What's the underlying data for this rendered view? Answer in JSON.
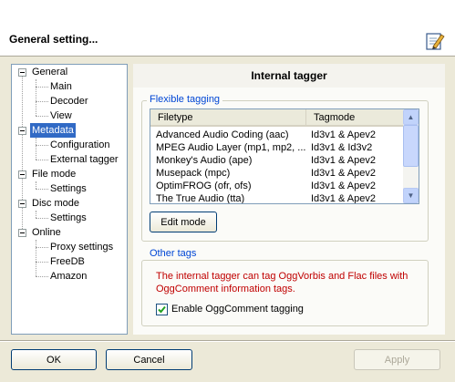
{
  "header": {
    "title": "General setting..."
  },
  "tree": {
    "items": [
      {
        "label": "General",
        "level": 0,
        "expanded": true,
        "selected": false
      },
      {
        "label": "Main",
        "level": 1,
        "selected": false
      },
      {
        "label": "Decoder",
        "level": 1,
        "selected": false
      },
      {
        "label": "View",
        "level": 1,
        "selected": false
      },
      {
        "label": "Metadata",
        "level": 0,
        "expanded": true,
        "selected": true
      },
      {
        "label": "Configuration",
        "level": 1,
        "selected": false
      },
      {
        "label": "External tagger",
        "level": 1,
        "selected": false
      },
      {
        "label": "File mode",
        "level": 0,
        "expanded": true,
        "selected": false
      },
      {
        "label": "Settings",
        "level": 1,
        "selected": false
      },
      {
        "label": "Disc mode",
        "level": 0,
        "expanded": true,
        "selected": false
      },
      {
        "label": "Settings",
        "level": 1,
        "selected": false
      },
      {
        "label": "Online",
        "level": 0,
        "expanded": true,
        "selected": false
      },
      {
        "label": "Proxy settings",
        "level": 1,
        "selected": false
      },
      {
        "label": "FreeDB",
        "level": 1,
        "selected": false
      },
      {
        "label": "Amazon",
        "level": 1,
        "selected": false
      }
    ]
  },
  "panel": {
    "title": "Internal tagger",
    "flexible": {
      "legend": "Flexible tagging",
      "columns": [
        "Filetype",
        "Tagmode"
      ],
      "rows": [
        [
          "Advanced Audio Coding (aac)",
          "Id3v1 & Apev2"
        ],
        [
          "MPEG Audio Layer (mp1, mp2, ...",
          "Id3v1 & Id3v2"
        ],
        [
          "Monkey's Audio (ape)",
          "Id3v1 & Apev2"
        ],
        [
          "Musepack (mpc)",
          "Id3v1 & Apev2"
        ],
        [
          "OptimFROG (ofr, ofs)",
          "Id3v1 & Apev2"
        ],
        [
          "The True Audio (tta)",
          "Id3v1 & Apev2"
        ]
      ],
      "edit_button": "Edit mode"
    },
    "other": {
      "legend": "Other tags",
      "note": "The internal tagger can tag OggVorbis and Flac files with OggComment information tags.",
      "checkbox_label": "Enable OggComment tagging",
      "checkbox_checked": true
    }
  },
  "footer": {
    "ok": "OK",
    "cancel": "Cancel",
    "apply": "Apply"
  },
  "colors": {
    "selection": "#316ac5",
    "legend": "#0046d5",
    "note": "#c00000"
  }
}
